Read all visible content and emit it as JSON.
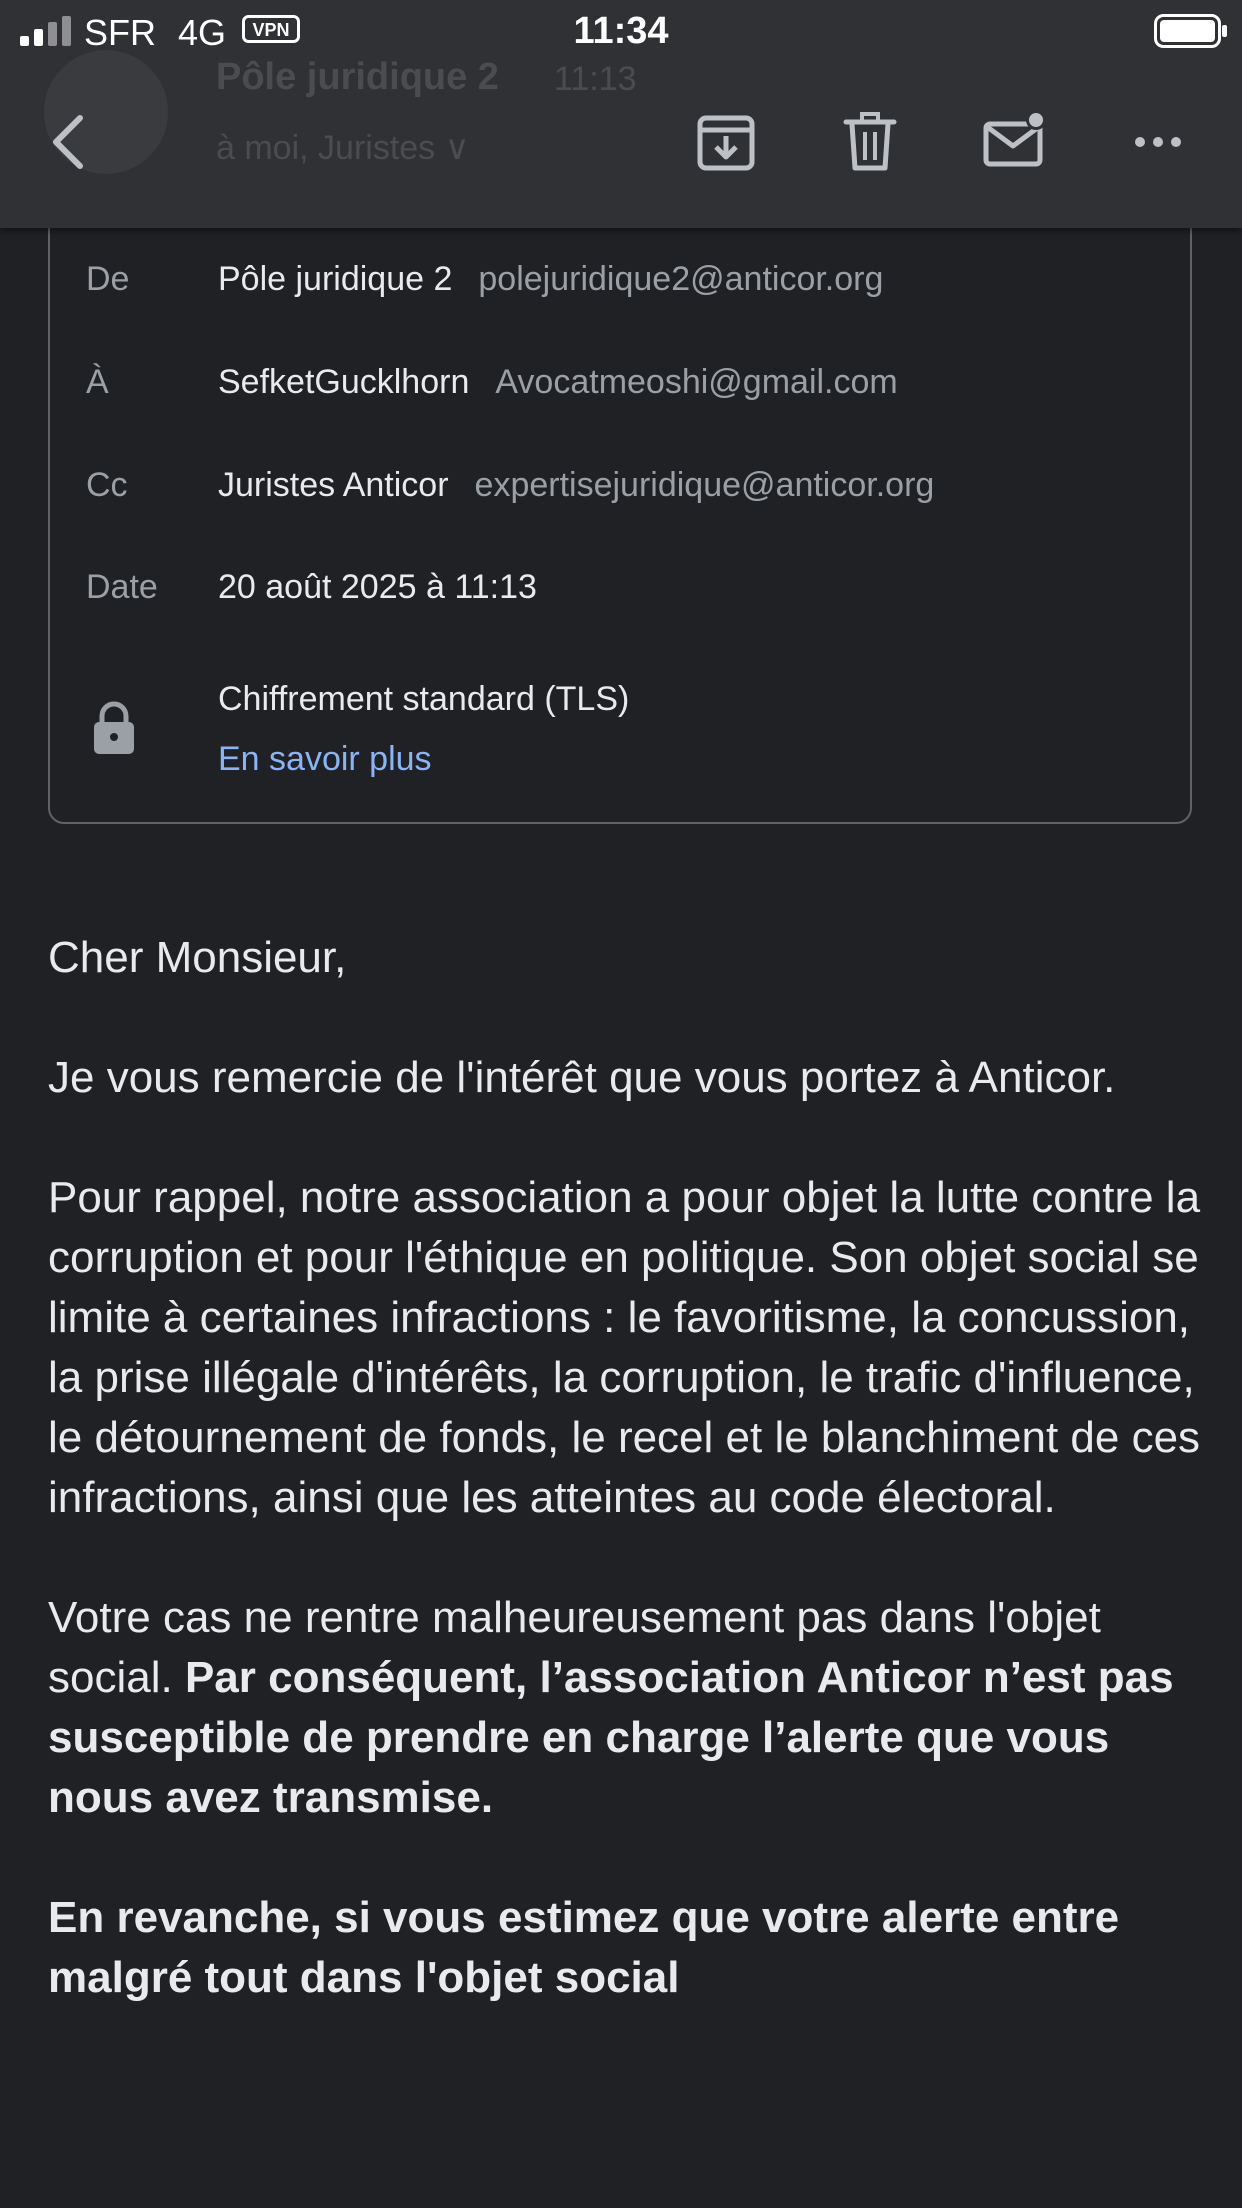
{
  "status_bar": {
    "carrier": "SFR",
    "network": "4G",
    "vpn": "VPN",
    "time": "11:34"
  },
  "header": {
    "sender": "Pôle juridique 2",
    "time": "11:13",
    "recipients": "à moi, Juristes ∨",
    "icons": [
      "back-icon",
      "archive-icon",
      "trash-icon",
      "mail-unread-icon",
      "more-icon"
    ]
  },
  "details": {
    "from": {
      "label": "De",
      "name": "Pôle juridique 2",
      "email": "polejuridique2@anticor.org"
    },
    "to": {
      "label": "À",
      "name": "SefketGucklhorn",
      "email": "Avocatmeoshi@gmail.com"
    },
    "cc": {
      "label": "Cc",
      "name": "Juristes Anticor",
      "email": "expertisejuridique@anticor.org"
    },
    "date": {
      "label": "Date",
      "value": "20 août 2025 à 11:13"
    },
    "encryption": "Chiffrement standard (TLS)",
    "learn_more": "En savoir plus"
  },
  "message": {
    "greeting": "Cher Monsieur,",
    "p1": "Je vous remercie de l'intérêt que vous portez à Anticor.",
    "p2": "Pour rappel, notre association a pour objet la lutte contre la corruption et pour l'éthique en politique. Son objet social se limite à certaines infractions : le favoritisme, la concussion, la prise illégale d'intérêts, la corruption, le trafic d'influence, le détournement de fonds, le recel et le blanchiment de ces infractions, ainsi que les atteintes au code électoral.",
    "p3_normal": "Votre cas ne rentre malheureusement pas dans l'objet social. ",
    "p3_bold": "Par conséquent, l’association Anticor n’est pas susceptible de prendre en charge l’alerte que vous nous avez transmise.",
    "p4_bold": "En revanche, si vous estimez que votre alerte entre malgré tout dans l'objet social"
  }
}
